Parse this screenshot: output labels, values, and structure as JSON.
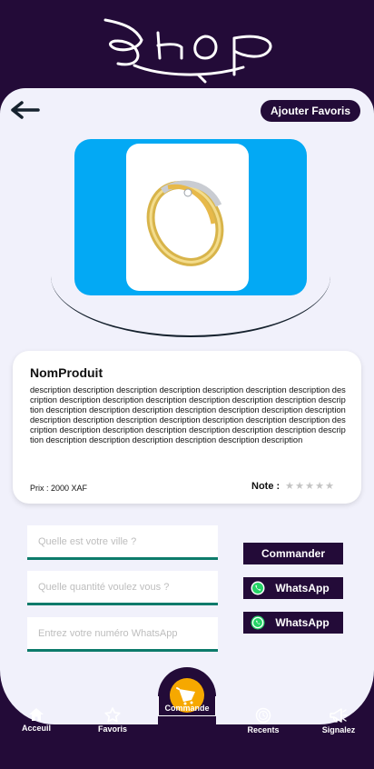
{
  "header": {
    "logo_text": "SHOP"
  },
  "top": {
    "favorite_label": "Ajouter Favoris"
  },
  "product": {
    "name": "NomProduit",
    "description": "description description description description description description description description description description description description description description description description description description description description description description description description description description description description description description description description description description description description description description description description description description description",
    "price": "Prix : 2000 XAF",
    "note_label": "Note :",
    "rating": 0,
    "rating_max": 5
  },
  "form": {
    "city_placeholder": "Quelle est votre ville ?",
    "quantity_placeholder": "Quelle quantité voulez vous ?",
    "whatsapp_placeholder": "Entrez votre numéro WhatsApp"
  },
  "actions": {
    "order_label": "Commander",
    "whatsapp_label_1": "WhatsApp",
    "whatsapp_label_2": "WhatsApp"
  },
  "nav": {
    "home": "Acceuil",
    "favorites": "Favoris",
    "order": "Commande",
    "recents": "Recents",
    "report": "Signalez"
  },
  "colors": {
    "primary": "#230b38",
    "accent": "#03a9f4",
    "field_underline": "#0d7b6b",
    "order_icon_bg": "#f6a800",
    "whatsapp_green": "#25d366"
  },
  "icons": [
    "back-arrow-icon",
    "ring-image",
    "star-icon",
    "whatsapp-icon",
    "home-icon",
    "star-outline-icon",
    "cart-icon",
    "recent-icon",
    "megaphone-icon"
  ]
}
